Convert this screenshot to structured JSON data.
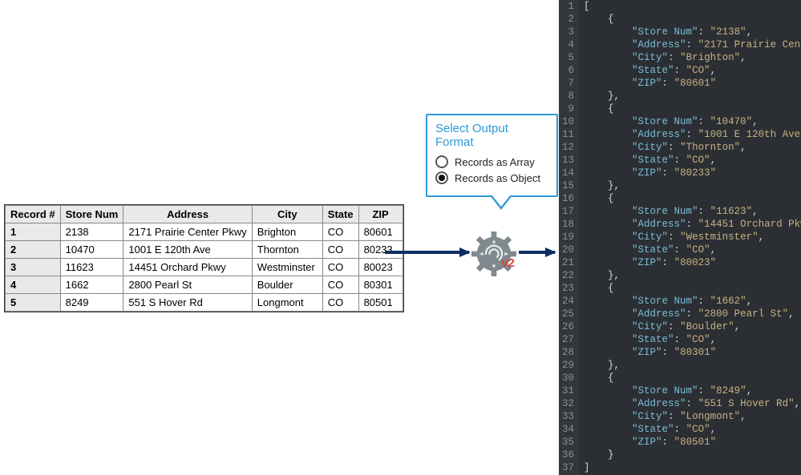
{
  "table": {
    "headers": {
      "record": "Record #",
      "store_num": "Store Num",
      "address": "Address",
      "city": "City",
      "state": "State",
      "zip": "ZIP"
    },
    "rows": [
      {
        "n": "1",
        "store_num": "2138",
        "address": "2171 Prairie Center Pkwy",
        "city": "Brighton",
        "state": "CO",
        "zip": "80601"
      },
      {
        "n": "2",
        "store_num": "10470",
        "address": "1001 E 120th Ave",
        "city": "Thornton",
        "state": "CO",
        "zip": "80233"
      },
      {
        "n": "3",
        "store_num": "11623",
        "address": "14451 Orchard Pkwy",
        "city": "Westminster",
        "state": "CO",
        "zip": "80023"
      },
      {
        "n": "4",
        "store_num": "1662",
        "address": "2800 Pearl St",
        "city": "Boulder",
        "state": "CO",
        "zip": "80301"
      },
      {
        "n": "5",
        "store_num": "8249",
        "address": "551 S Hover Rd",
        "city": "Longmont",
        "state": "CO",
        "zip": "80501"
      }
    ]
  },
  "popup": {
    "title": "Select Output Format",
    "options": {
      "array": "Records as Array",
      "object": "Records as Object"
    },
    "selected": "object"
  },
  "node": {
    "label": "v2"
  },
  "code_keys": {
    "store_num": "Store Num",
    "address": "Address",
    "city": "City",
    "state": "State",
    "zip": "ZIP"
  }
}
